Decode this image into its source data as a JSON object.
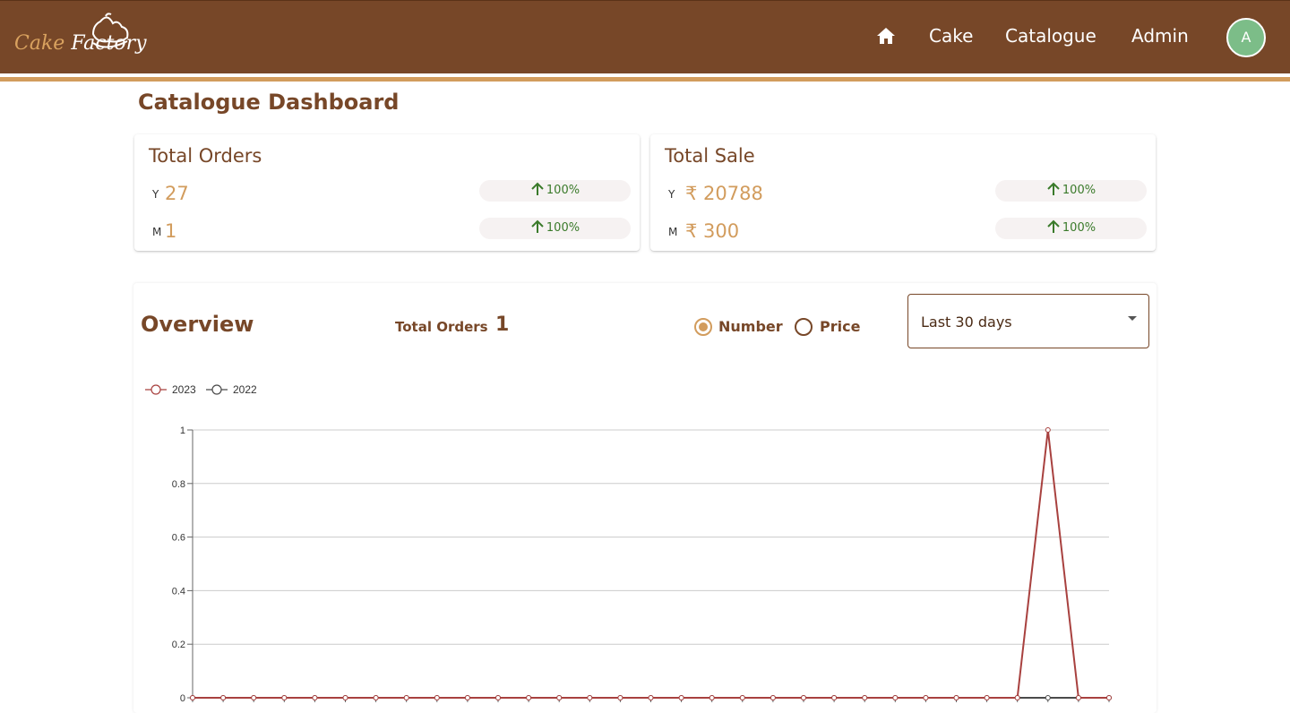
{
  "header": {
    "logo_word_1": "Cake",
    "logo_word_2": "Factory",
    "nav": [
      "Cake",
      "Catalogue",
      "Admin"
    ],
    "avatar_initial": "A"
  },
  "page_title": "Catalogue Dashboard",
  "cards": [
    {
      "title": "Total Orders",
      "rows": [
        {
          "label": "Y",
          "value": "27",
          "change": "100%"
        },
        {
          "label": "M",
          "value": "1",
          "change": "100%"
        }
      ]
    },
    {
      "title": "Total Sale",
      "rows": [
        {
          "label": "Y",
          "value": "₹ 20788",
          "change": "100%"
        },
        {
          "label": "M",
          "value": "₹ 300",
          "change": "100%"
        }
      ]
    }
  ],
  "overview": {
    "title": "Overview",
    "total_orders_label": "Total Orders",
    "total_orders_value": "1",
    "radio_options": [
      "Number",
      "Price"
    ],
    "selected_option": "Number",
    "range_select": "Last 30 days"
  },
  "colors": {
    "brand_brown": "#774728",
    "accent_gold": "#d29c5d",
    "up_green": "#3a7a2a",
    "series_2023": "#a8413f",
    "series_2022": "#4a4a4a"
  },
  "chart_data": {
    "type": "line",
    "ylim": [
      0,
      1
    ],
    "yticks": [
      "0",
      "0.2",
      "0.4",
      "0.6",
      "0.8",
      "1"
    ],
    "grid": true,
    "legend_position": "top-left",
    "series": [
      {
        "name": "2023",
        "color": "#a8413f",
        "values": [
          0,
          0,
          0,
          0,
          0,
          0,
          0,
          0,
          0,
          0,
          0,
          0,
          0,
          0,
          0,
          0,
          0,
          0,
          0,
          0,
          0,
          0,
          0,
          0,
          0,
          0,
          0,
          0,
          1,
          0,
          0
        ]
      },
      {
        "name": "2022",
        "color": "#4a4a4a",
        "values": [
          0,
          0,
          0,
          0,
          0,
          0,
          0,
          0,
          0,
          0,
          0,
          0,
          0,
          0,
          0,
          0,
          0,
          0,
          0,
          0,
          0,
          0,
          0,
          0,
          0,
          0,
          0,
          0,
          0,
          0,
          0
        ]
      }
    ]
  }
}
